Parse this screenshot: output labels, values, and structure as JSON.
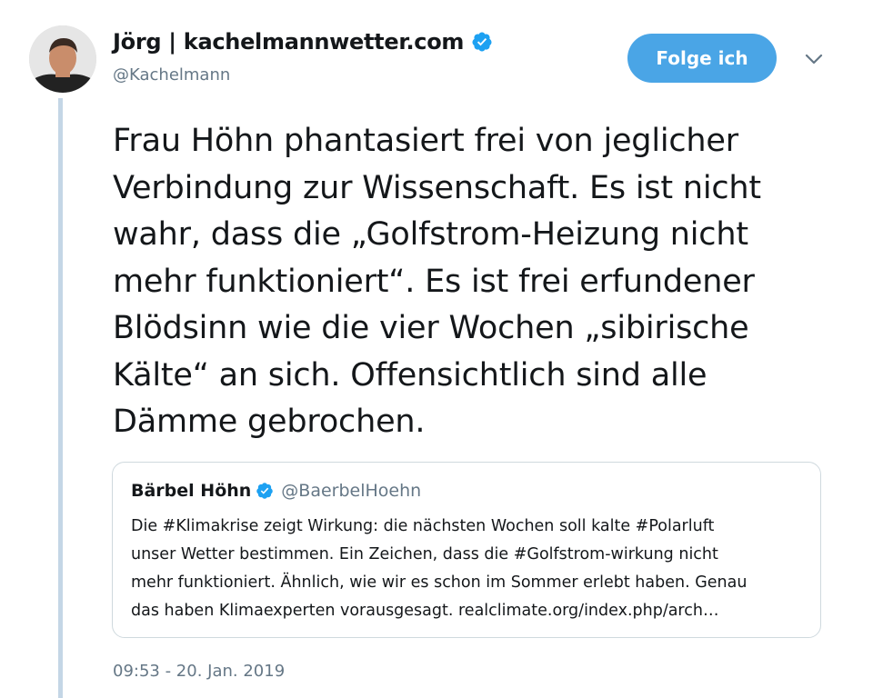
{
  "tweet": {
    "author": {
      "display_name": "Jörg | kachelmannwetter.com",
      "handle": "@Kachelmann",
      "verified_icon": "verified-badge-icon"
    },
    "follow_button_label": "Folge ich",
    "menu_icon": "chevron-down-icon",
    "text": "Frau Höhn phantasiert frei von jeglicher\nVerbindung zur Wissenschaft. Es ist nicht\nwahr, dass die „Golfstrom-Heizung nicht\nmehr funktioniert“. Es ist frei erfundener\nBlödsinn wie die vier Wochen „sibirische\nKälte“ an sich. Offensichtlich sind alle\nDämme gebrochen.",
    "timestamp": "09:53 - 20. Jan. 2019"
  },
  "quoted_tweet": {
    "author_name": "Bärbel Höhn",
    "author_handle": "@BaerbelHoehn",
    "text": "Die #Klimakrise zeigt Wirkung: die nächsten Wochen soll kalte #Polarluft\nunser Wetter bestimmen. Ein Zeichen, dass die #Golfstrom-wirkung nicht\nmehr funktioniert. Ähnlich, wie wir es schon im Sommer erlebt haben. Genau\ndas haben Klimaexperten vorausgesagt. realclimate.org/index.php/arch…"
  },
  "colors": {
    "accent": "#1da1f2",
    "follow_button": "#4aa5e6",
    "secondary_text": "#657786",
    "thread_line": "#c4d6e6"
  }
}
